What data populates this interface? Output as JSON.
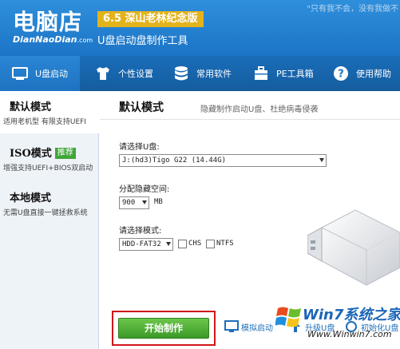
{
  "header": {
    "logo_cn": "电脑店",
    "logo_en": "DianNaoDian",
    "logo_en_suffix": ".com",
    "version_badge": "6.5 深山老林纪念版",
    "tool_name": "U盘启动盘制作工具",
    "tray_hint": "\"只有我不会，没有我做不"
  },
  "nav": {
    "items": [
      {
        "label": "U盘启动",
        "icon": "usb-drive-icon"
      },
      {
        "label": "个性设置",
        "icon": "tshirt-icon"
      },
      {
        "label": "常用软件",
        "icon": "database-icon"
      },
      {
        "label": "PE工具箱",
        "icon": "toolbox-icon"
      },
      {
        "label": "使用帮助",
        "icon": "help-icon"
      }
    ]
  },
  "sidebar": {
    "items": [
      {
        "title": "默认模式",
        "desc": "适用老机型 有限支持UEFI"
      },
      {
        "title": "ISO模式",
        "tag": "推荐",
        "desc": "增强支持UEFI+BIOS双启动"
      },
      {
        "title": "本地模式",
        "desc": "无需U盘直接一键拯救系统"
      }
    ]
  },
  "main": {
    "mode_title": "默认模式",
    "mode_desc": "隐藏制作启动U盘、杜绝病毒侵袭",
    "usb_label": "请选择U盘:",
    "usb_value": "J:(hd3)Tigo G22 (14.44G)",
    "partition_label": "分配隐藏空间:",
    "partition_value": "900",
    "partition_unit": "MB",
    "mode_label": "请选择模式:",
    "mode_value": "HDD-FAT32",
    "chs_label": "CHS",
    "ntfs_label": "NTFS",
    "start_button": "开始制作",
    "link_simulate": "模拟启动",
    "link_upgrade": "升级U盘",
    "link_restore": "初始化U盘"
  },
  "watermark": {
    "title": "Win7系统之家",
    "url": "Www.Winwin7.com"
  },
  "colors": {
    "header_blue": "#1c74c6",
    "version_gold": "#e3b31c",
    "start_green": "#4aab33",
    "highlight_red": "#d0161a",
    "recommend_green": "#41a63a"
  }
}
